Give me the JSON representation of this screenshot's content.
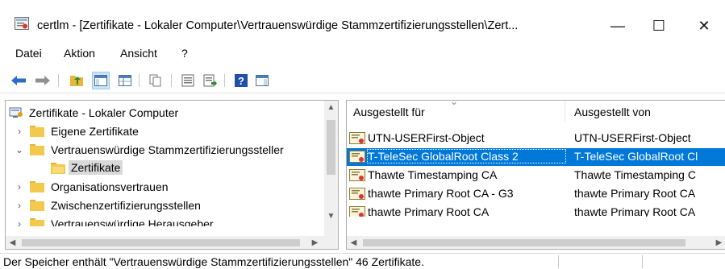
{
  "window": {
    "title": "certlm - [Zertifikate - Lokaler Computer\\Vertrauenswürdige Stammzertifizierungsstellen\\Zert...",
    "minimize": "—",
    "maximize": "☐",
    "close": "✕"
  },
  "menu": {
    "items": [
      "Datei",
      "Aktion",
      "Ansicht",
      "?"
    ]
  },
  "toolbar": {
    "icons": [
      "back-arrow-icon",
      "forward-arrow-icon",
      "up-folder-icon",
      "show-hide-tree-icon",
      "copy-icon",
      "properties-icon",
      "export-list-icon",
      "help-icon",
      "action-pane-icon"
    ]
  },
  "tree": {
    "root": "Zertifikate - Lokaler Computer",
    "items": [
      {
        "label": "Eigene Zertifikate",
        "expander": "›"
      },
      {
        "label": "Vertrauenswürdige Stammzertifizierungssteller",
        "expander": "⌄"
      },
      {
        "label": "Zertifikate",
        "expander": ""
      },
      {
        "label": "Organisationsvertrauen",
        "expander": "›"
      },
      {
        "label": "Zwischenzertifizierungsstellen",
        "expander": "›"
      },
      {
        "label": "Vertrauenswürdige Herausgeber",
        "expander": "›"
      }
    ]
  },
  "list": {
    "columns": [
      "Ausgestellt für",
      "Ausgestellt von"
    ],
    "rows": [
      {
        "issued_to": "UTN-USERFirst-Object",
        "issued_by": "UTN-USERFirst-Object",
        "selected": false
      },
      {
        "issued_to": "T-TeleSec GlobalRoot Class 2",
        "issued_by": "T-TeleSec GlobalRoot Cl",
        "selected": true
      },
      {
        "issued_to": "Thawte Timestamping CA",
        "issued_by": "Thawte Timestamping C",
        "selected": false
      },
      {
        "issued_to": "thawte Primary Root CA - G3",
        "issued_by": "thawte Primary Root CA",
        "selected": false
      },
      {
        "issued_to": "thawte Primary Root CA",
        "issued_by": "thawte Primary Root CA",
        "selected": false
      }
    ]
  },
  "status": {
    "text": "Der Speicher enthält \"Vertrauenswürdige Stammzertifizierungsstellen\" 46 Zertifikate."
  },
  "colors": {
    "selection": "#0078d7",
    "folder": "#f2c94c"
  }
}
